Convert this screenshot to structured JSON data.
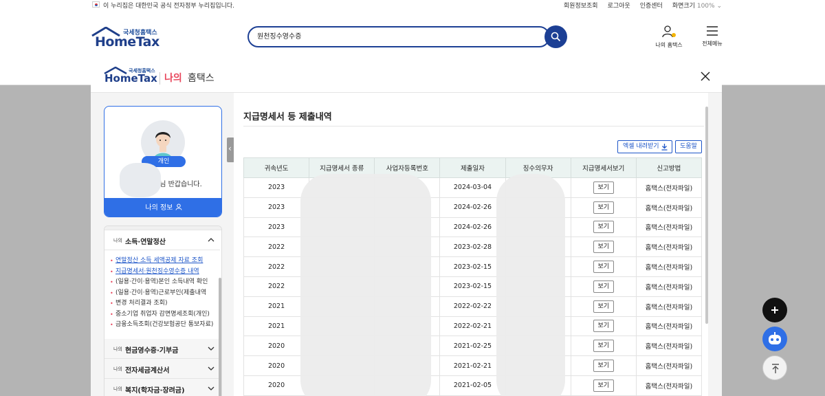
{
  "gov_banner": {
    "notice": "이 누리집은 대한민국 공식 전자정부 누리집입니다.",
    "links": [
      "회원정보조회",
      "로그아웃",
      "인증센터",
      "화면크기"
    ],
    "font_size_value": "100%"
  },
  "header": {
    "logo_sub": "국세청홈택스",
    "logo_main": "HomeTax",
    "search_value": "원천징수영수증",
    "my_hometax_label": "나의 홈택스",
    "all_menu_label": "전체메뉴"
  },
  "modal": {
    "logo_sub": "국세청홈택스",
    "logo_main": "HomeTax",
    "title_my": "나의",
    "title_hometax": "홈택스"
  },
  "profile": {
    "badge": "개인",
    "greeting": "님 반갑습니다.",
    "my_info_label": "나의 정보"
  },
  "menu": {
    "sections": [
      {
        "prefix": "나의",
        "title": "소득·연말정산",
        "expanded": true
      },
      {
        "prefix": "나의",
        "title": "현금영수증·기부금",
        "expanded": false
      },
      {
        "prefix": "나의",
        "title": "전자세금계산서",
        "expanded": false
      },
      {
        "prefix": "나의",
        "title": "복지(학자금·장려금)",
        "expanded": false
      }
    ],
    "sub_items": [
      "연말정산 소득 세액공제 자료 조회",
      "지급명세서·원천징수영수증 내역",
      "(일용·간이·용역)본인 소득내역 확인",
      "(일용·간이·용역)근로부인(제출내역",
      "변경 처리결과 조회)",
      "중소기업 취업자 감면명세조회(개인)",
      "금융소득조회(건강보험공단 통보자료)"
    ]
  },
  "content": {
    "title": "지급명세서 등 제출내역",
    "excel_button": "엑셀 내려받기",
    "help_button": "도움말",
    "columns": [
      "귀속년도",
      "지급명세서 종류",
      "사업자등록번호",
      "제출일자",
      "징수의무자",
      "지급명세서보기",
      "신고방법"
    ],
    "rows": [
      {
        "year": "2023",
        "date": "2024-03-04",
        "view": "보기",
        "method": "홈택스(전자파일)"
      },
      {
        "year": "2023",
        "date": "2024-02-26",
        "view": "보기",
        "method": "홈택스(전자파일)"
      },
      {
        "year": "2023",
        "date": "2024-02-26",
        "view": "보기",
        "method": "홈택스(전자파일)"
      },
      {
        "year": "2022",
        "date": "2023-02-28",
        "view": "보기",
        "method": "홈택스(전자파일)"
      },
      {
        "year": "2022",
        "date": "2023-02-15",
        "view": "보기",
        "method": "홈택스(전자파일)"
      },
      {
        "year": "2022",
        "date": "2023-02-15",
        "view": "보기",
        "method": "홈택스(전자파일)"
      },
      {
        "year": "2021",
        "date": "2022-02-22",
        "view": "보기",
        "method": "홈택스(전자파일)"
      },
      {
        "year": "2021",
        "date": "2022-02-21",
        "view": "보기",
        "method": "홈택스(전자파일)"
      },
      {
        "year": "2020",
        "date": "2021-02-25",
        "view": "보기",
        "method": "홈택스(전자파일)"
      },
      {
        "year": "2020",
        "date": "2021-02-21",
        "view": "보기",
        "method": "홈택스(전자파일)"
      },
      {
        "year": "2020",
        "date": "2021-02-05",
        "view": "보기",
        "method": "홈택스(전자파일)"
      }
    ]
  },
  "colors": {
    "brand_navy": "#1c3f94",
    "accent_blue": "#2f6fe6",
    "accent_red": "#e8465c",
    "table_header_bg": "#ebf3f1"
  },
  "icons": [
    "search-icon",
    "my-hometax-icon",
    "hamburger-menu-icon",
    "close-icon",
    "download-icon",
    "user-icon",
    "chevron-icon",
    "plus-icon",
    "chatbot-icon",
    "scroll-top-icon"
  ]
}
